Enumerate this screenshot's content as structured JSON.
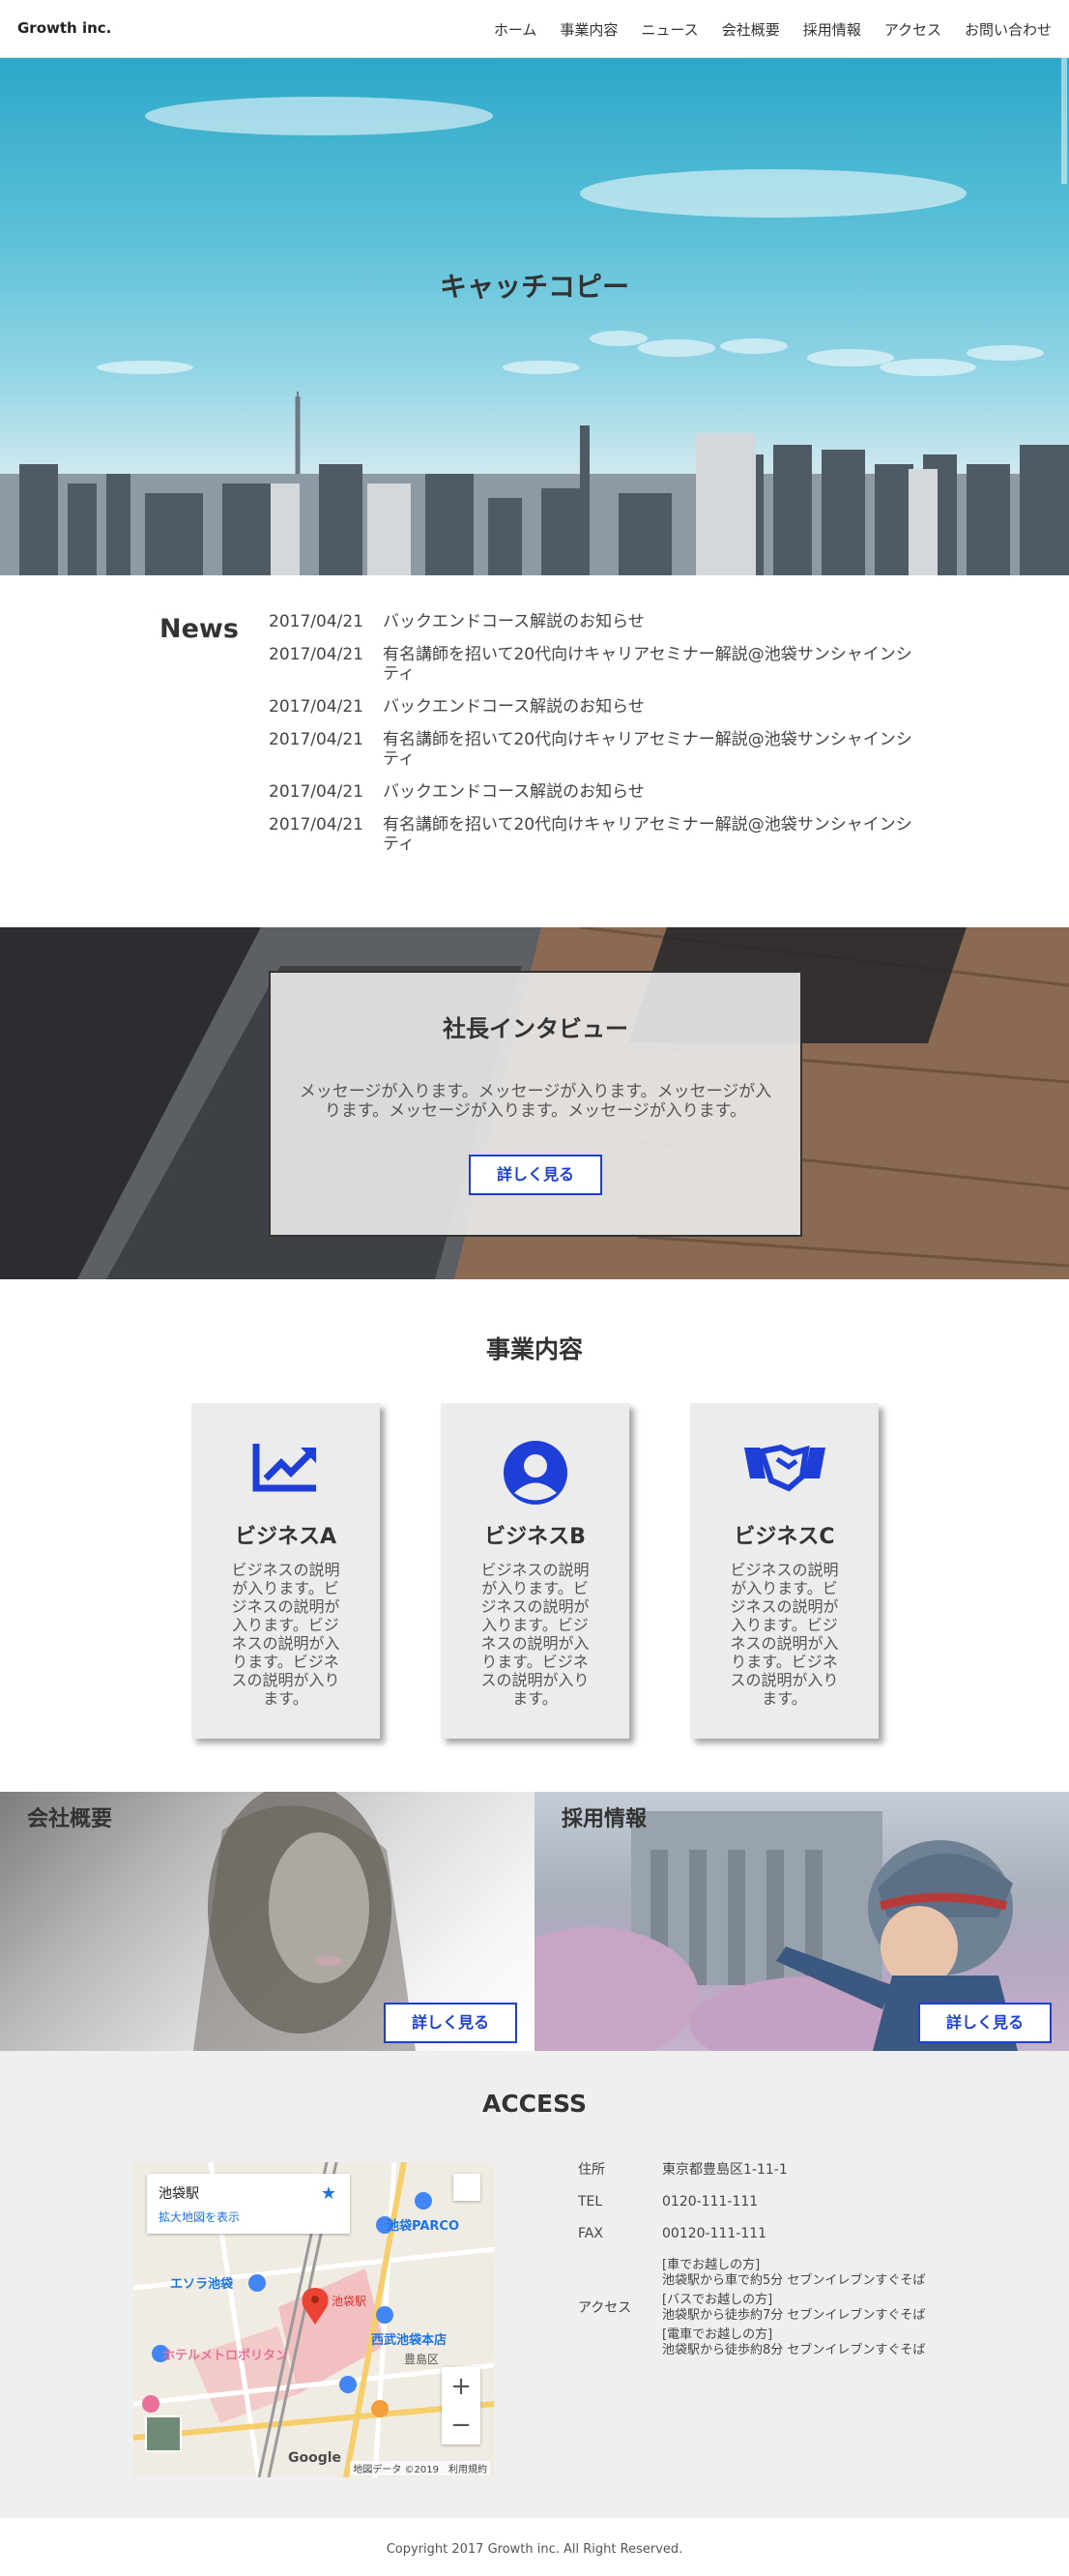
{
  "header": {
    "brand": "Growth inc.",
    "nav": [
      "ホーム",
      "事業内容",
      "ニュース",
      "会社概要",
      "採用情報",
      "アクセス",
      "お問い合わせ"
    ]
  },
  "hero": {
    "catch_copy": "キャッチコピー"
  },
  "news": {
    "heading": "News",
    "items": [
      {
        "date": "2017/04/21",
        "title": "バックエンドコース解説のお知らせ"
      },
      {
        "date": "2017/04/21",
        "title": "有名講師を招いて20代向けキャリアセミナー解説@池袋サンシャインシティ"
      },
      {
        "date": "2017/04/21",
        "title": "バックエンドコース解説のお知らせ"
      },
      {
        "date": "2017/04/21",
        "title": "有名講師を招いて20代向けキャリアセミナー解説@池袋サンシャインシティ"
      },
      {
        "date": "2017/04/21",
        "title": "バックエンドコース解説のお知らせ"
      },
      {
        "date": "2017/04/21",
        "title": "有名講師を招いて20代向けキャリアセミナー解説@池袋サンシャインシティ"
      }
    ]
  },
  "interview": {
    "title": "社長インタビュー",
    "message": "メッセージが入ります。メッセージが入ります。メッセージが入ります。メッセージが入ります。メッセージが入ります。",
    "button": "詳しく見る"
  },
  "business": {
    "title": "事業内容",
    "cards": [
      {
        "name": "ビジネスA",
        "icon": "chart-line-icon",
        "desc": "ビジネスの説明が入ります。ビジネスの説明が入ります。ビジネスの説明が入ります。ビジネスの説明が入ります。"
      },
      {
        "name": "ビジネスB",
        "icon": "user-circle-icon",
        "desc": "ビジネスの説明が入ります。ビジネスの説明が入ります。ビジネスの説明が入ります。ビジネスの説明が入ります。"
      },
      {
        "name": "ビジネスC",
        "icon": "handshake-icon",
        "desc": "ビジネスの説明が入ります。ビジネスの説明が入ります。ビジネスの説明が入ります。ビジネスの説明が入ります。"
      }
    ]
  },
  "company": {
    "title": "会社概要",
    "button": "詳しく見る"
  },
  "recruit": {
    "title": "採用情報",
    "button": "詳しく見る"
  },
  "access": {
    "title": "ACCESS",
    "map": {
      "place_name": "池袋駅",
      "enlarge_link": "拡大地図を表示",
      "zoom_in": "+",
      "zoom_out": "−",
      "credit": "地図データ ©2019　利用規約",
      "logo": "Google",
      "labels": [
        "池袋PARCO",
        "エソラ池袋",
        "池袋駅",
        "西武池袋本店",
        "ホテルメトロポリタン",
        "豊島区"
      ]
    },
    "rows": [
      {
        "label": "住所",
        "value": "東京都豊島区1-11-1"
      },
      {
        "label": "TEL",
        "value": "0120-111-111"
      },
      {
        "label": "FAX",
        "value": "00120-111-111"
      }
    ],
    "access_label": "アクセス",
    "access_lines": [
      {
        "head": "[車でお越しの方]",
        "text": "池袋駅から車で約5分 セブンイレブンすぐそば"
      },
      {
        "head": "[バスでお越しの方]",
        "text": "池袋駅から徒歩約7分 セブンイレブンすぐそば"
      },
      {
        "head": "[電車でお越しの方]",
        "text": "池袋駅から徒歩約8分 セブンイレブンすぐそば"
      }
    ]
  },
  "footer": {
    "copyright": "Copyright 2017 Growth inc. All Right Reserved."
  },
  "colors": {
    "accent": "#1d3fd8",
    "section_gray": "#efefef",
    "card_gray": "#ececec"
  }
}
